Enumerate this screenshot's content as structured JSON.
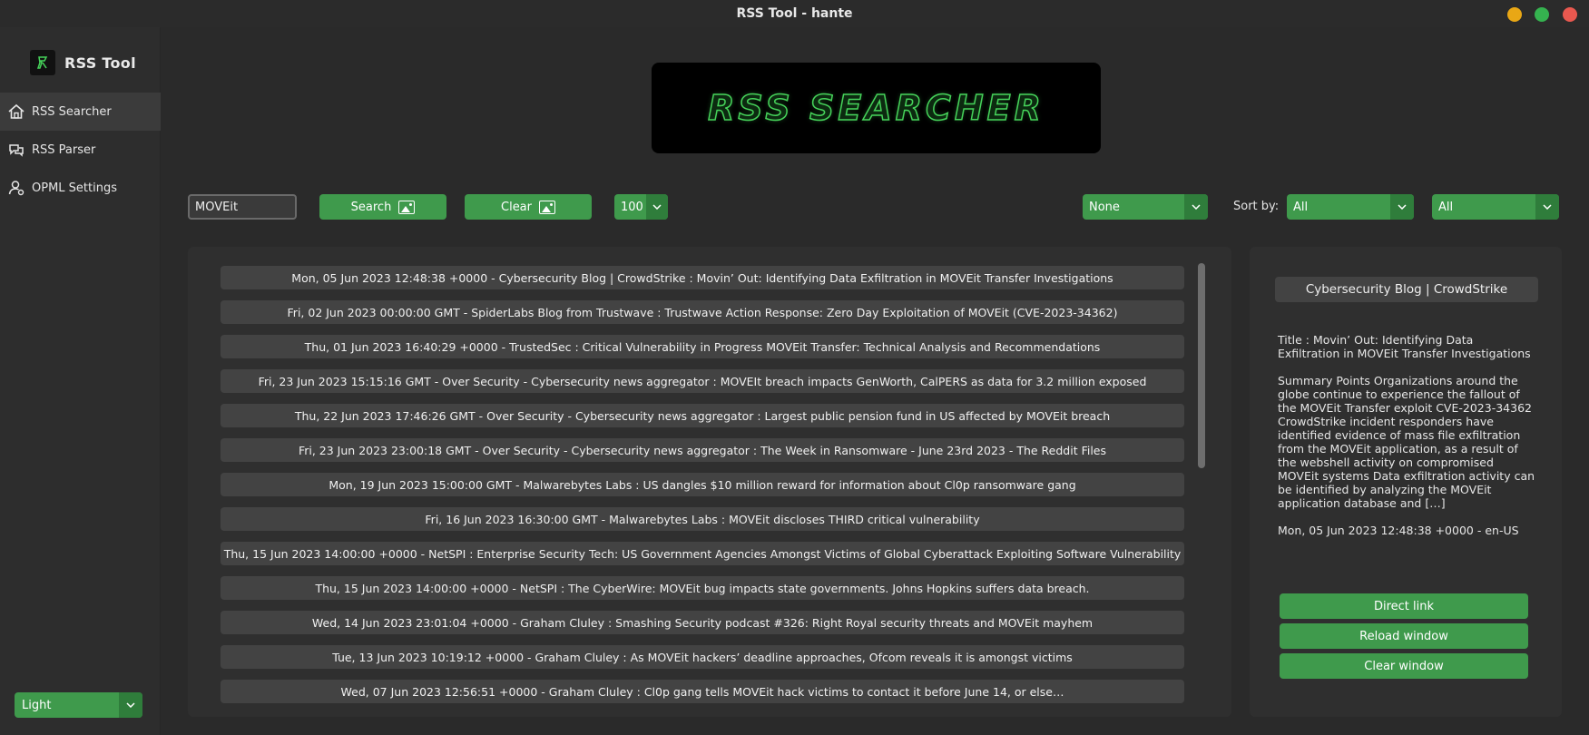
{
  "window": {
    "title": "RSS Tool - hante"
  },
  "sidebar": {
    "app_name": "RSS Tool",
    "items": [
      {
        "label": "RSS Searcher",
        "icon": "home-icon",
        "active": true
      },
      {
        "label": "RSS Parser",
        "icon": "chat-bubbles-icon",
        "active": false
      },
      {
        "label": "OPML Settings",
        "icon": "user-settings-icon",
        "active": false
      }
    ],
    "theme_select": {
      "value": "Light"
    }
  },
  "banner": {
    "text": "RSS SEARCHER"
  },
  "toolbar": {
    "search_value": "MOVEit",
    "search_label": "Search",
    "clear_label": "Clear",
    "count_value": "100",
    "filter_value": "None",
    "sort_label": "Sort by:",
    "sort_value_1": "All",
    "sort_value_2": "All"
  },
  "results": [
    "Mon, 05 Jun 2023 12:48:38 +0000 - Cybersecurity Blog | CrowdStrike : Movin’ Out: Identifying Data Exfiltration in MOVEit Transfer Investigations",
    "Fri, 02 Jun 2023 00:00:00 GMT - SpiderLabs Blog from Trustwave : Trustwave Action Response: Zero Day Exploitation of MOVEit (CVE-2023-34362)",
    "Thu, 01 Jun 2023 16:40:29 +0000 - TrustedSec : Critical Vulnerability in Progress MOVEit Transfer: Technical Analysis and Recommendations",
    "Fri, 23 Jun 2023 15:15:16 GMT - Over Security - Cybersecurity news aggregator : MOVEIt breach impacts GenWorth, CalPERS as data for 3.2 million exposed",
    "Thu, 22 Jun 2023 17:46:26 GMT - Over Security - Cybersecurity news aggregator : Largest public pension fund in US affected by MOVEit breach",
    "Fri, 23 Jun 2023 23:00:18 GMT - Over Security - Cybersecurity news aggregator : The Week in Ransomware - June 23rd 2023 - The Reddit Files",
    "Mon, 19 Jun 2023 15:00:00 GMT - Malwarebytes Labs : US dangles $10 million reward for information about Cl0p ransomware gang",
    "Fri, 16 Jun 2023 16:30:00 GMT - Malwarebytes Labs : MOVEit discloses THIRD critical vulnerability",
    "Thu, 15 Jun 2023 14:00:00 +0000 - NetSPI : Enterprise Security Tech: US Government Agencies Amongst Victims of Global Cyberattack Exploiting Software Vulnerability",
    "Thu, 15 Jun 2023 14:00:00 +0000 - NetSPI : The CyberWire: MOVEit bug impacts state governments. Johns Hopkins suffers data breach.",
    "Wed, 14 Jun 2023 23:01:04 +0000 - Graham Cluley : Smashing Security podcast #326: Right Royal security threats and MOVEit mayhem",
    "Tue, 13 Jun 2023 10:19:12 +0000 - Graham Cluley : As MOVEit hackers’ deadline approaches, Ofcom reveals it is amongst victims",
    "Wed, 07 Jun 2023 12:56:51 +0000 - Graham Cluley : Cl0p gang tells MOVEit hack victims to contact it before June 14, or else…"
  ],
  "detail": {
    "source": "Cybersecurity Blog | CrowdStrike",
    "title_line": "Title : Movin’ Out: Identifying Data Exfiltration in MOVEit Transfer Investigations",
    "summary": "Summary Points Organizations around the globe continue to experience the fallout of the MOVEit Transfer exploit CVE-2023-34362 CrowdStrike incident responders have identified evidence of mass file exfiltration from the MOVEit application, as a result of the webshell activity on compromised MOVEit systems Data exfiltration activity can be identified by analyzing the MOVEit application database and […]",
    "meta": "Mon, 05 Jun 2023 12:48:38 +0000 - en-US",
    "direct_link_label": "Direct link",
    "reload_label": "Reload window",
    "clear_label": "Clear window"
  },
  "colors": {
    "accent": "#3f9a4c",
    "accent_dark": "#2f7d3b",
    "background": "#2a2a2a",
    "panel": "#2f2f2f"
  }
}
